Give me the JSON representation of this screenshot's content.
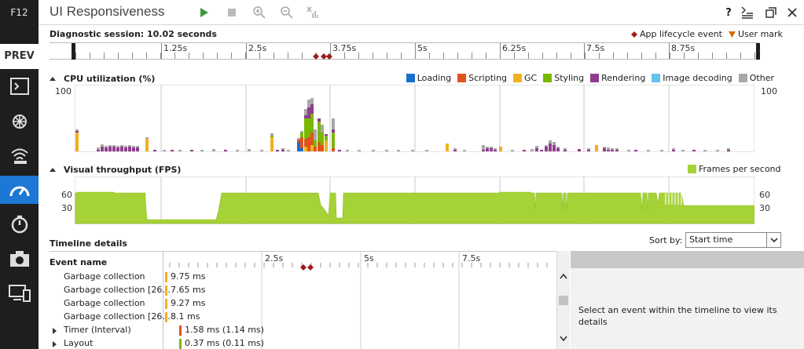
{
  "rail": {
    "f12_label": "F12",
    "prev_label": "PREV"
  },
  "titlebar": {
    "title": "UI Responsiveness",
    "help_label": "?"
  },
  "session": {
    "label": "Diagnostic session: 10.02 seconds",
    "legend": [
      {
        "label": "App lifecycle event",
        "color": "#a01c1c"
      },
      {
        "label": "User mark",
        "color": "#d96b0a"
      }
    ],
    "ticks": [
      "1.25s",
      "2.5s",
      "3.75s",
      "5s",
      "6.25s",
      "7.5s",
      "8.75s"
    ]
  },
  "cpu": {
    "header": "CPU utilization (%)",
    "axis_top": "100",
    "legend": [
      {
        "label": "Loading",
        "color": "#1a6fc9"
      },
      {
        "label": "Scripting",
        "color": "#e0531b"
      },
      {
        "label": "GC",
        "color": "#f2b01e"
      },
      {
        "label": "Styling",
        "color": "#7ab800"
      },
      {
        "label": "Rendering",
        "color": "#8f3c8f"
      },
      {
        "label": "Image decoding",
        "color": "#5ec4ec"
      },
      {
        "label": "Other",
        "color": "#a8a8a8"
      }
    ]
  },
  "fps": {
    "header": "Visual throughput (FPS)",
    "legend_label": "Frames per second",
    "legend_color": "#a5d236",
    "axis_60": "60",
    "axis_30": "30"
  },
  "details": {
    "header": "Timeline details",
    "sort_label": "Sort by:",
    "sort_value": "Start time",
    "col_header": "Event name",
    "ticks": [
      "2.5s",
      "5s",
      "7.5s"
    ],
    "placeholder": "Select an event within the timeline to view its details",
    "events": [
      {
        "name": "Garbage collection",
        "duration": "9.75 ms",
        "color": "#f2b01e",
        "expandable": false
      },
      {
        "name": "Garbage collection [26...",
        "duration": "7.65 ms",
        "color": "#f2b01e",
        "expandable": false
      },
      {
        "name": "Garbage collection",
        "duration": "9.27 ms",
        "color": "#f2b01e",
        "expandable": false
      },
      {
        "name": "Garbage collection [26...",
        "duration": "8.1 ms",
        "color": "#f2b01e",
        "expandable": false
      },
      {
        "name": "Timer (Interval)",
        "duration": "1.58 ms (1.14 ms)",
        "color": "#e0531b",
        "expandable": true
      },
      {
        "name": "Layout",
        "duration": "0.37 ms (0.11 ms)",
        "color": "#7ab800",
        "expandable": true
      }
    ]
  }
}
